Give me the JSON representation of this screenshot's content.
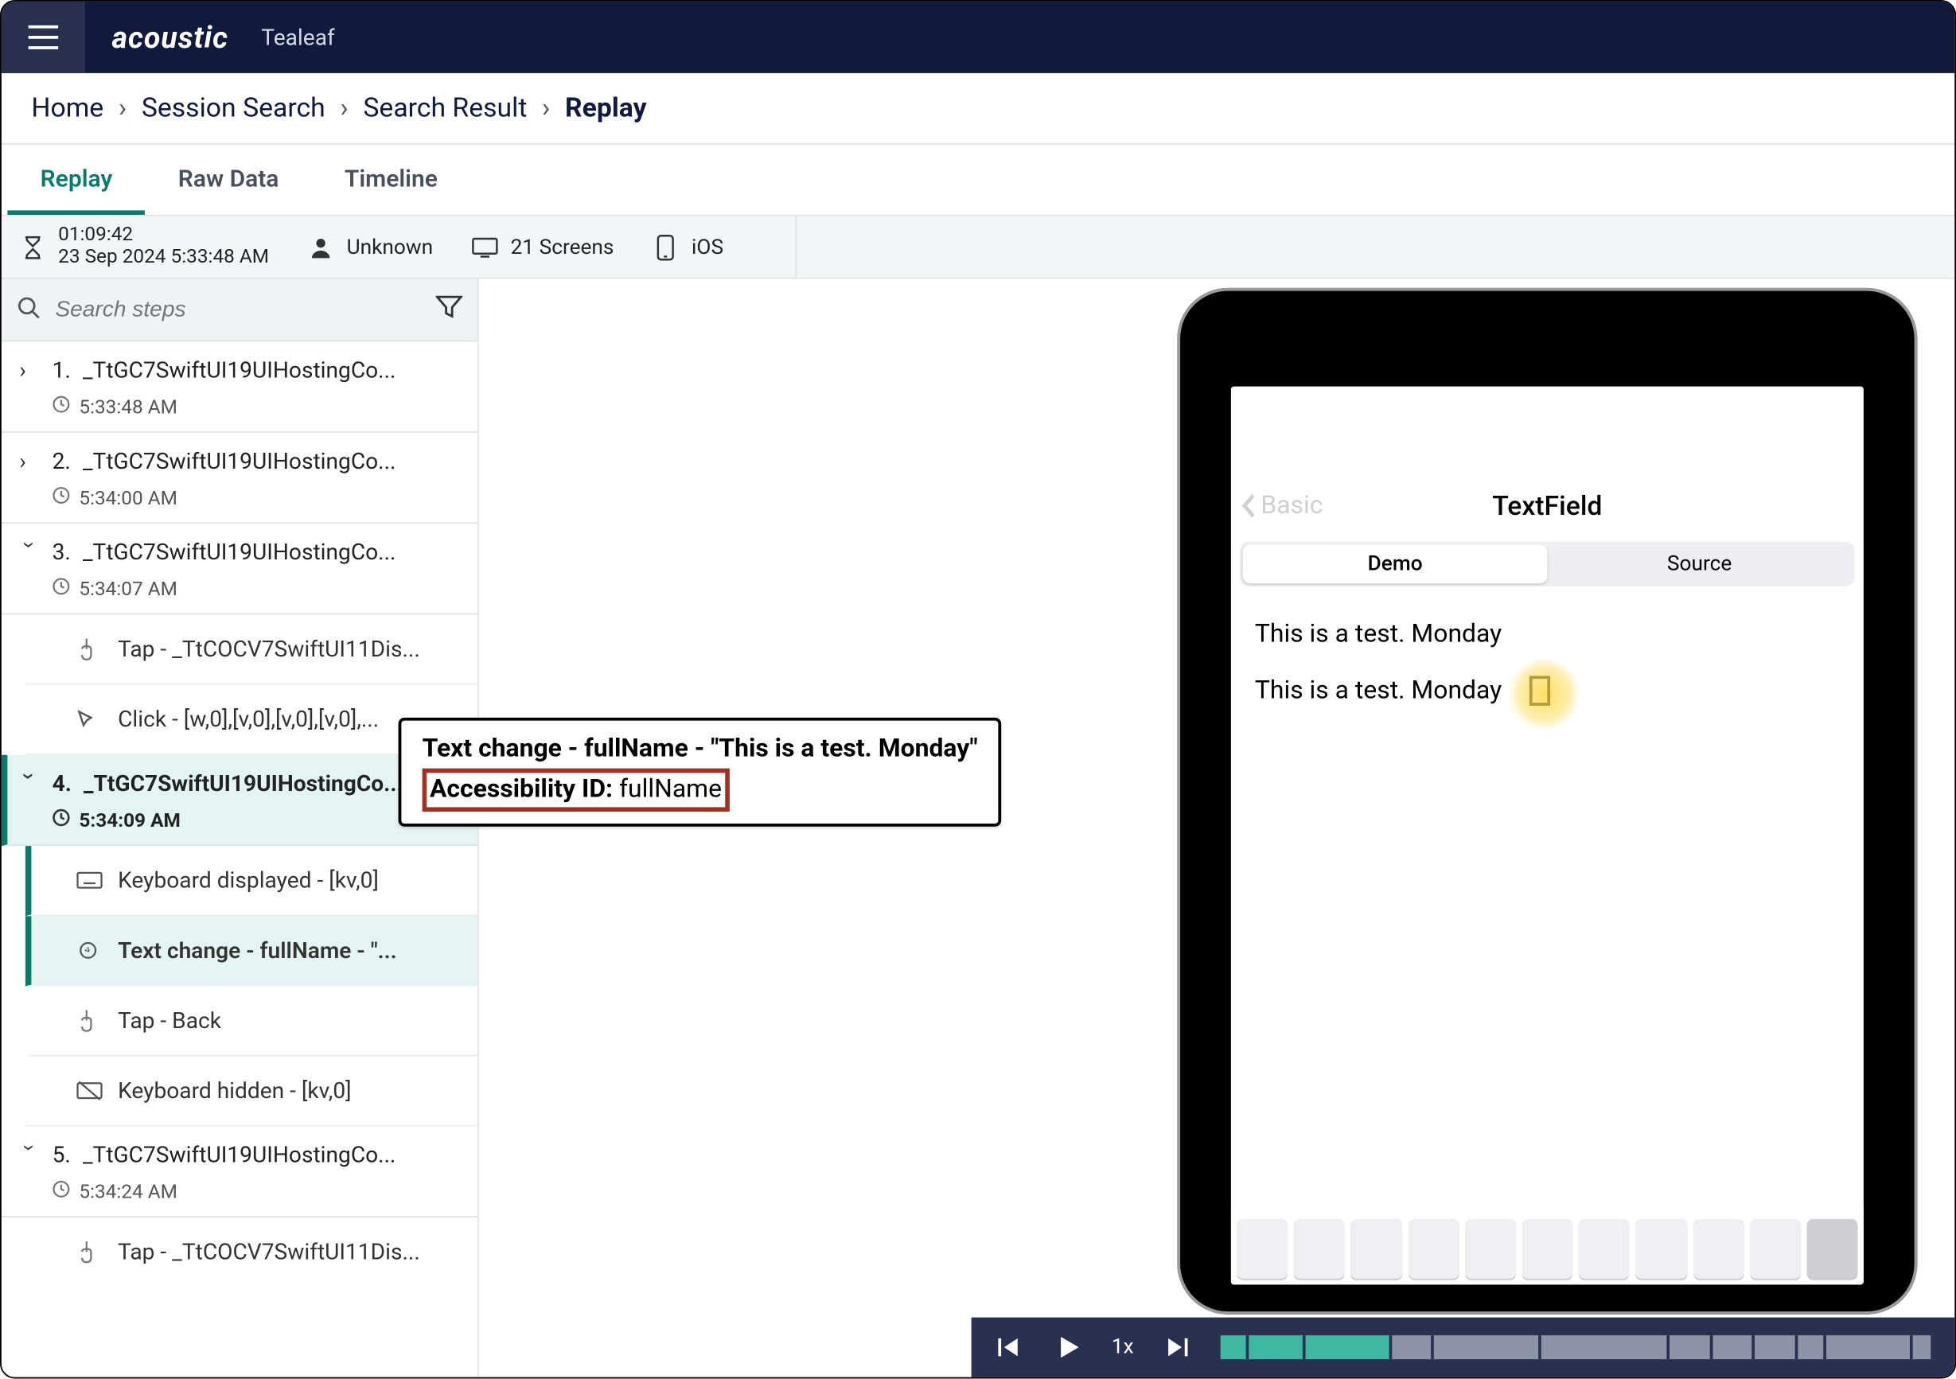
{
  "brand": {
    "name": "acoustic",
    "product": "Tealeaf"
  },
  "breadcrumb": {
    "items": [
      "Home",
      "Session Search",
      "Search Result"
    ],
    "current": "Replay"
  },
  "tabs": {
    "items": [
      {
        "label": "Replay",
        "active": true
      },
      {
        "label": "Raw Data",
        "active": false
      },
      {
        "label": "Timeline",
        "active": false
      }
    ]
  },
  "meta": {
    "duration": "01:09:42",
    "datetime": "23 Sep 2024 5:33:48 AM",
    "user": "Unknown",
    "screens": "21 Screens",
    "platform": "iOS"
  },
  "search": {
    "placeholder": "Search steps"
  },
  "steps": [
    {
      "index": "1.",
      "label": "_TtGC7SwiftUI19UIHostingCo...",
      "time": "5:33:48 AM",
      "expanded": false
    },
    {
      "index": "2.",
      "label": "_TtGC7SwiftUI19UIHostingCo...",
      "time": "5:34:00 AM",
      "expanded": false
    },
    {
      "index": "3.",
      "label": "_TtGC7SwiftUI19UIHostingCo...",
      "time": "5:34:07 AM",
      "expanded": true,
      "substeps": [
        {
          "icon": "tap",
          "label": "Tap - _TtCOCV7SwiftUI11Dis..."
        },
        {
          "icon": "click",
          "label": "Click - [w,0],[v,0],[v,0],[v,0],..."
        }
      ]
    },
    {
      "index": "4.",
      "label": "_TtGC7SwiftUI19UIHostingCo...",
      "time": "5:34:09 AM",
      "expanded": true,
      "active": true,
      "substeps": [
        {
          "icon": "keyboard",
          "label": "Keyboard displayed - [kv,0]"
        },
        {
          "icon": "textchange",
          "label": "Text change - fullName - \"...",
          "selected": true
        },
        {
          "icon": "tap",
          "label": "Tap - Back"
        },
        {
          "icon": "keyboard-off",
          "label": "Keyboard hidden - [kv,0]"
        }
      ]
    },
    {
      "index": "5.",
      "label": "_TtGC7SwiftUI19UIHostingCo...",
      "time": "5:34:24 AM",
      "expanded": true,
      "substeps": [
        {
          "icon": "tap",
          "label": "Tap - _TtCOCV7SwiftUI11Dis..."
        }
      ]
    }
  ],
  "tooltip": {
    "line1": "Text change - fullName - \"This is a test. Monday\"",
    "id_label": "Accessibility ID:",
    "id_value": "fullName"
  },
  "device": {
    "back_label": "Basic",
    "title": "TextField",
    "segments": [
      "Demo",
      "Source"
    ],
    "line1": "This is a test. Monday",
    "line2": "This is a test. Monday"
  },
  "player": {
    "speed": "1x",
    "segments": [
      {
        "state": "done",
        "w": 4
      },
      {
        "state": "done",
        "w": 8
      },
      {
        "state": "done",
        "w": 12
      },
      {
        "state": "pending",
        "w": 6
      },
      {
        "state": "pending",
        "w": 15
      },
      {
        "state": "pending",
        "w": 18
      },
      {
        "state": "pending",
        "w": 6
      },
      {
        "state": "pending",
        "w": 6
      },
      {
        "state": "pending",
        "w": 6
      },
      {
        "state": "pending",
        "w": 4
      },
      {
        "state": "pending",
        "w": 12
      },
      {
        "state": "pending",
        "w": 3
      }
    ]
  }
}
